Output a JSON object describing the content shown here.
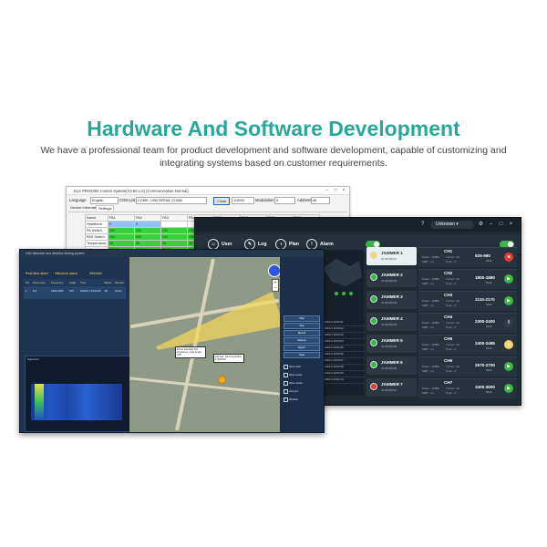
{
  "headline": "Hardware And Software Development",
  "subline": "We have a professional team for product development and software development, capable of customizing and integrating systems based on customer requirements.",
  "colors": {
    "accent": "#2aa79b",
    "dark_bg": "#1f2a33",
    "green": "#3bb54a",
    "red": "#e53935",
    "yellow": "#f1d36a"
  },
  "win1": {
    "title": "ELS PRO2000 Control System(V2.50.1.0) (Communication Normal)",
    "language_label": "Language",
    "language_value": "English",
    "com_label": "COM List",
    "com_value": "COM5 : USB SERIAL CH340",
    "close_button": "Close",
    "baud_value": "115200",
    "modulation_label": "Modulation",
    "modulation_value": "0",
    "address_label": "Address",
    "address_value": "All",
    "tabs": [
      "Device Information",
      "Settings"
    ],
    "columns": [
      "Name",
      "PA1",
      "PA2",
      "PA3",
      "PA4",
      "PA5",
      "PA6",
      "PA7",
      "PA8"
    ],
    "rows": [
      {
        "name": "Heartbeat",
        "cells": [
          "0",
          "0",
          "",
          "",
          "",
          "",
          "",
          ""
        ]
      },
      {
        "name": "PA Switch",
        "cells": [
          "ON",
          "ON",
          "ON",
          "ON",
          "",
          "",
          "",
          ""
        ]
      },
      {
        "name": "PAS Switch",
        "cells": [
          "ON",
          "ON",
          "ON",
          "ON",
          "",
          "",
          "",
          ""
        ]
      },
      {
        "name": "Temperature",
        "cells": [
          "29",
          "30",
          "29",
          "30",
          "",
          "",
          "",
          ""
        ]
      },
      {
        "name": "Voltage",
        "cells": [
          "26.17",
          "26.17",
          "26.17",
          "26.17",
          "",
          "",
          "",
          ""
        ]
      }
    ]
  },
  "win2": {
    "unknown_label": "Unknown",
    "nav": [
      {
        "label": "User",
        "icon": "user-icon",
        "glyph": "☺"
      },
      {
        "label": "Log",
        "icon": "log-icon",
        "glyph": "✎"
      },
      {
        "label": "Plan",
        "icon": "plan-icon",
        "glyph": "◑"
      },
      {
        "label": "Alarm",
        "icon": "alarm-icon",
        "glyph": "!"
      }
    ],
    "jammers": [
      {
        "name": "JAMMER 1",
        "sub": "ID:00000001",
        "dot": "#f1d36a"
      },
      {
        "name": "JAMMER 2",
        "sub": "ID:00000002",
        "dot": "#3bb54a"
      },
      {
        "name": "JAMMER 3",
        "sub": "ID:00000003",
        "dot": "#3bb54a"
      },
      {
        "name": "JAMMER 4",
        "sub": "ID:00000004",
        "dot": "#3bb54a"
      },
      {
        "name": "JAMMER 5",
        "sub": "ID:00000005",
        "dot": "#3bb54a"
      },
      {
        "name": "JAMMER 6",
        "sub": "ID:00000006",
        "dot": "#3bb54a"
      },
      {
        "name": "JAMMER 7",
        "sub": "ID:00000007",
        "dot": "#e53935"
      }
    ],
    "channels": [
      {
        "name": "CH1",
        "freq": "925-960",
        "unit": "MHZ",
        "power": "Power : 10dBm",
        "current": "Current : 0A",
        "swr": "SWR : 1.0",
        "temp": "Temp : 0°",
        "action": "stop",
        "color": "#e53935",
        "glyph": "■"
      },
      {
        "name": "CH2",
        "freq": "1800-1880",
        "unit": "MHZ",
        "power": "Power : 10dBm",
        "current": "Current : 0A",
        "swr": "SWR : 1.0",
        "temp": "Temp : 0°",
        "action": "play",
        "color": "#3bb54a",
        "glyph": "▶"
      },
      {
        "name": "CH3",
        "freq": "2110-2170",
        "unit": "MHZ",
        "power": "Power : 10dBm",
        "current": "Current : 0A",
        "swr": "SWR : 1.0",
        "temp": "Temp : 0°",
        "action": "play",
        "color": "#3bb54a",
        "glyph": "▶"
      },
      {
        "name": "CH4",
        "freq": "2300-2400",
        "unit": "MHZ",
        "power": "Power : 10dBm",
        "current": "Current : 0A",
        "swr": "SWR : 1.0",
        "temp": "Temp : 0°",
        "action": "pause",
        "color": "#2f3d48",
        "glyph": "‖"
      },
      {
        "name": "CH5",
        "freq": "2400-2485",
        "unit": "MHZ",
        "power": "Power : 10dBm",
        "current": "Current : 0A",
        "swr": "SWR : 1.0",
        "temp": "Temp : 0°",
        "action": "pause",
        "color": "#f1d36a",
        "glyph": "●"
      },
      {
        "name": "CH6",
        "freq": "2570-2700",
        "unit": "MHZ",
        "power": "Power : 10dBm",
        "current": "Current : 0A",
        "swr": "SWR : 1.0",
        "temp": "Temp : 0°",
        "action": "play",
        "color": "#3bb54a",
        "glyph": "▶"
      },
      {
        "name": "CH7",
        "freq": "3400-3600",
        "unit": "MHZ",
        "power": "Power : 10dBm",
        "current": "Current : 0A",
        "swr": "SWR : 1.0",
        "temp": "Temp : 0°",
        "action": "play",
        "color": "#3bb54a",
        "glyph": "▶"
      }
    ],
    "log_rows": [
      "2024/1/1 10:00:01",
      "2024/1/1 10:00:02",
      "2024/1/1 10:00:03",
      "2024/1/1 10:00:04",
      "2024/1/1 10:00:05",
      "2024/1/1 10:00:06",
      "2024/1/1 10:00:07",
      "2024/1/1 10:00:08",
      "2024/1/1 10:00:09",
      "2024/1/1 10:00:10"
    ]
  },
  "win3": {
    "title": "UAV detection and direction finding system",
    "tabs": [
      "Real-time alarm",
      "Historical alarm",
      "Whitelist"
    ],
    "table_headers": [
      "NO",
      "Drone type",
      "Frequency",
      "Angle",
      "Time",
      "Signal",
      "Remark"
    ],
    "table_row": [
      "1",
      "DJI",
      "2400-2485",
      "105",
      "2024/1/1 10:00:00",
      "-60",
      "Drone"
    ],
    "spectrum_title": "Spectrum",
    "callouts": [
      "Drone detected: DJI Frequency: 2.4G Angle: 105°",
      "Jammer: Jamming active 2.4G/5.8G"
    ],
    "buttons": [
      "Start",
      "Stop",
      "Record",
      "Settings",
      "Export",
      "Clear"
    ],
    "checks": [
      "Show track",
      "Show sector",
      "Alarm sound",
      "Auto jam",
      "Whitelist"
    ]
  }
}
